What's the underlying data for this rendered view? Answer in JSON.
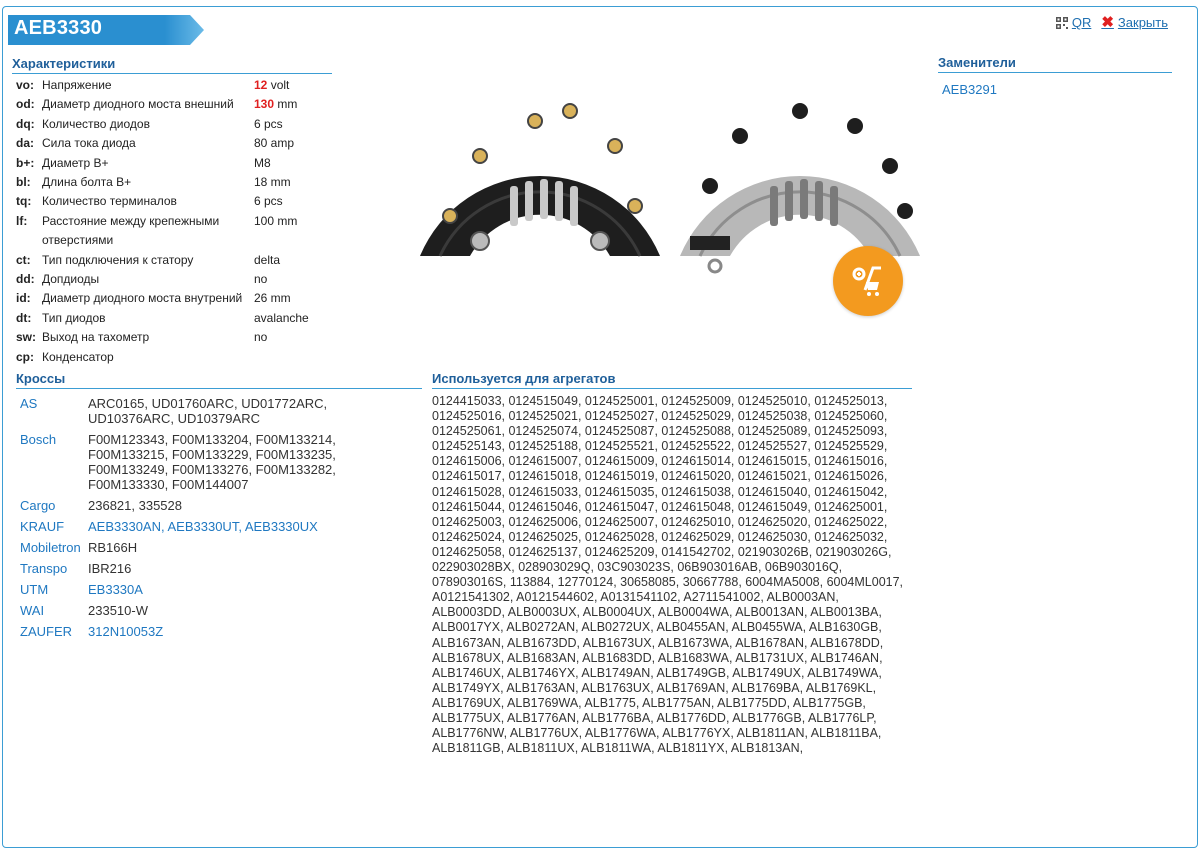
{
  "header": {
    "title": "AEB3330",
    "qr_label": "QR",
    "close_label": "Закрыть"
  },
  "specs": {
    "heading": "Характеристики",
    "rows": [
      {
        "code": "vo:",
        "name": "Напряжение",
        "value_num": "12",
        "value_unit": " volt",
        "highlight": true
      },
      {
        "code": "od:",
        "name": "Диаметр диодного моста внешний",
        "value_num": "130",
        "value_unit": " mm",
        "highlight": true
      },
      {
        "code": "dq:",
        "name": "Количество диодов",
        "value": "6 pcs"
      },
      {
        "code": "da:",
        "name": "Сила тока диода",
        "value": "80 amp"
      },
      {
        "code": "b+:",
        "name": "Диаметр B+",
        "value": "M8"
      },
      {
        "code": "bl:",
        "name": "Длина болта B+",
        "value": "18 mm"
      },
      {
        "code": "tq:",
        "name": "Количество терминалов",
        "value": "6 pcs"
      },
      {
        "code": "lf:",
        "name": "Расстояние между крепежными отверстиями",
        "value": "100 mm"
      },
      {
        "code": "ct:",
        "name": "Тип подключения к статору",
        "value": "delta"
      },
      {
        "code": "dd:",
        "name": "Допдиоды",
        "value": "no"
      },
      {
        "code": "id:",
        "name": "Диаметр диодного моста внутрений",
        "value": "26 mm"
      },
      {
        "code": "dt:",
        "name": "Тип диодов",
        "value": "avalanche"
      },
      {
        "code": "sw:",
        "name": "Выход на тахометр",
        "value": "no"
      },
      {
        "code": "cp:",
        "name": "Конденсатор",
        "value": ""
      }
    ]
  },
  "crosses": {
    "heading": "Кроссы",
    "rows": [
      {
        "brand": "AS",
        "values": "ARC0165, UD01760ARC, UD01772ARC, UD10376ARC, UD10379ARC",
        "link": false
      },
      {
        "brand": "Bosch",
        "values": "F00M123343, F00M133204, F00M133214, F00M133215, F00M133229, F00M133235, F00M133249, F00M133276, F00M133282, F00M133330, F00M144007",
        "link": false
      },
      {
        "brand": "Cargo",
        "values": "236821, 335528",
        "link": false
      },
      {
        "brand": "KRAUF",
        "values": "AEB3330AN, AEB3330UT, AEB3330UX",
        "link": true
      },
      {
        "brand": "Mobiletron",
        "values": "RB166H",
        "link": false
      },
      {
        "brand": "Transpo",
        "values": "IBR216",
        "link": false
      },
      {
        "brand": "UTM",
        "values": "EB3330A",
        "link": true
      },
      {
        "brand": "WAI",
        "values": "233510-W",
        "link": false
      },
      {
        "brand": "ZAUFER",
        "values": "312N10053Z",
        "link": true
      }
    ]
  },
  "used_in": {
    "heading": "Используется для агрегатов",
    "text": "0124415033, 0124515049, 0124525001, 0124525009, 0124525010, 0124525013, 0124525016, 0124525021, 0124525027, 0124525029, 0124525038, 0124525060, 0124525061, 0124525074, 0124525087, 0124525088, 0124525089, 0124525093, 0124525143, 0124525188, 0124525521, 0124525522, 0124525527, 0124525529, 0124615006, 0124615007, 0124615009, 0124615014, 0124615015, 0124615016, 0124615017, 0124615018, 0124615019, 0124615020, 0124615021, 0124615026, 0124615028, 0124615033, 0124615035, 0124615038, 0124615040, 0124615042, 0124615044, 0124615046, 0124615047, 0124615048, 0124615049, 0124625001, 0124625003, 0124625006, 0124625007, 0124625010, 0124625020, 0124625022, 0124625024, 0124625025, 0124625028, 0124625029, 0124625030, 0124625032, 0124625058, 0124625137, 0124625209, 0141542702, 021903026B, 021903026G, 022903028BX, 028903029Q, 03C903023S, 06B903016AB, 06B903016Q, 078903016S, 113884, 12770124, 30658085, 30667788, 6004MA5008, 6004ML0017, A0121541302, A0121544602, A0131541102, A2711541002, ALB0003AN, ALB0003DD, ALB0003UX, ALB0004UX, ALB0004WA, ALB0013AN, ALB0013BA, ALB0017YX, ALB0272AN, ALB0272UX, ALB0455AN, ALB0455WA, ALB1630GB, ALB1673AN, ALB1673DD, ALB1673UX, ALB1673WA, ALB1678AN, ALB1678DD, ALB1678UX, ALB1683AN, ALB1683DD, ALB1683WA, ALB1731UX, ALB1746AN, ALB1746UX, ALB1746YX, ALB1749AN, ALB1749GB, ALB1749UX, ALB1749WA, ALB1749YX, ALB1763AN, ALB1763UX, ALB1769AN, ALB1769BA, ALB1769KL, ALB1769UX, ALB1769WA, ALB1775, ALB1775AN, ALB1775DD, ALB1775GB, ALB1775UX, ALB1776AN, ALB1776BA, ALB1776DD, ALB1776GB, ALB1776LP, ALB1776NW, ALB1776UX, ALB1776WA, ALB1776YX, ALB1811AN, ALB1811BA, ALB1811GB, ALB1811UX, ALB1811WA, ALB1811YX, ALB1813AN,"
  },
  "replacements": {
    "heading": "Заменители",
    "items": [
      "AEB3291"
    ]
  },
  "colors": {
    "accent": "#3b9dd4",
    "title_ribbon": "#2a8fd0",
    "link": "#1f78c1",
    "highlight": "#e02020",
    "cart": "#f39a1f"
  },
  "icons": {
    "qr": "qr-code-icon",
    "close": "close-x-icon",
    "cart": "add-to-cart-icon"
  }
}
